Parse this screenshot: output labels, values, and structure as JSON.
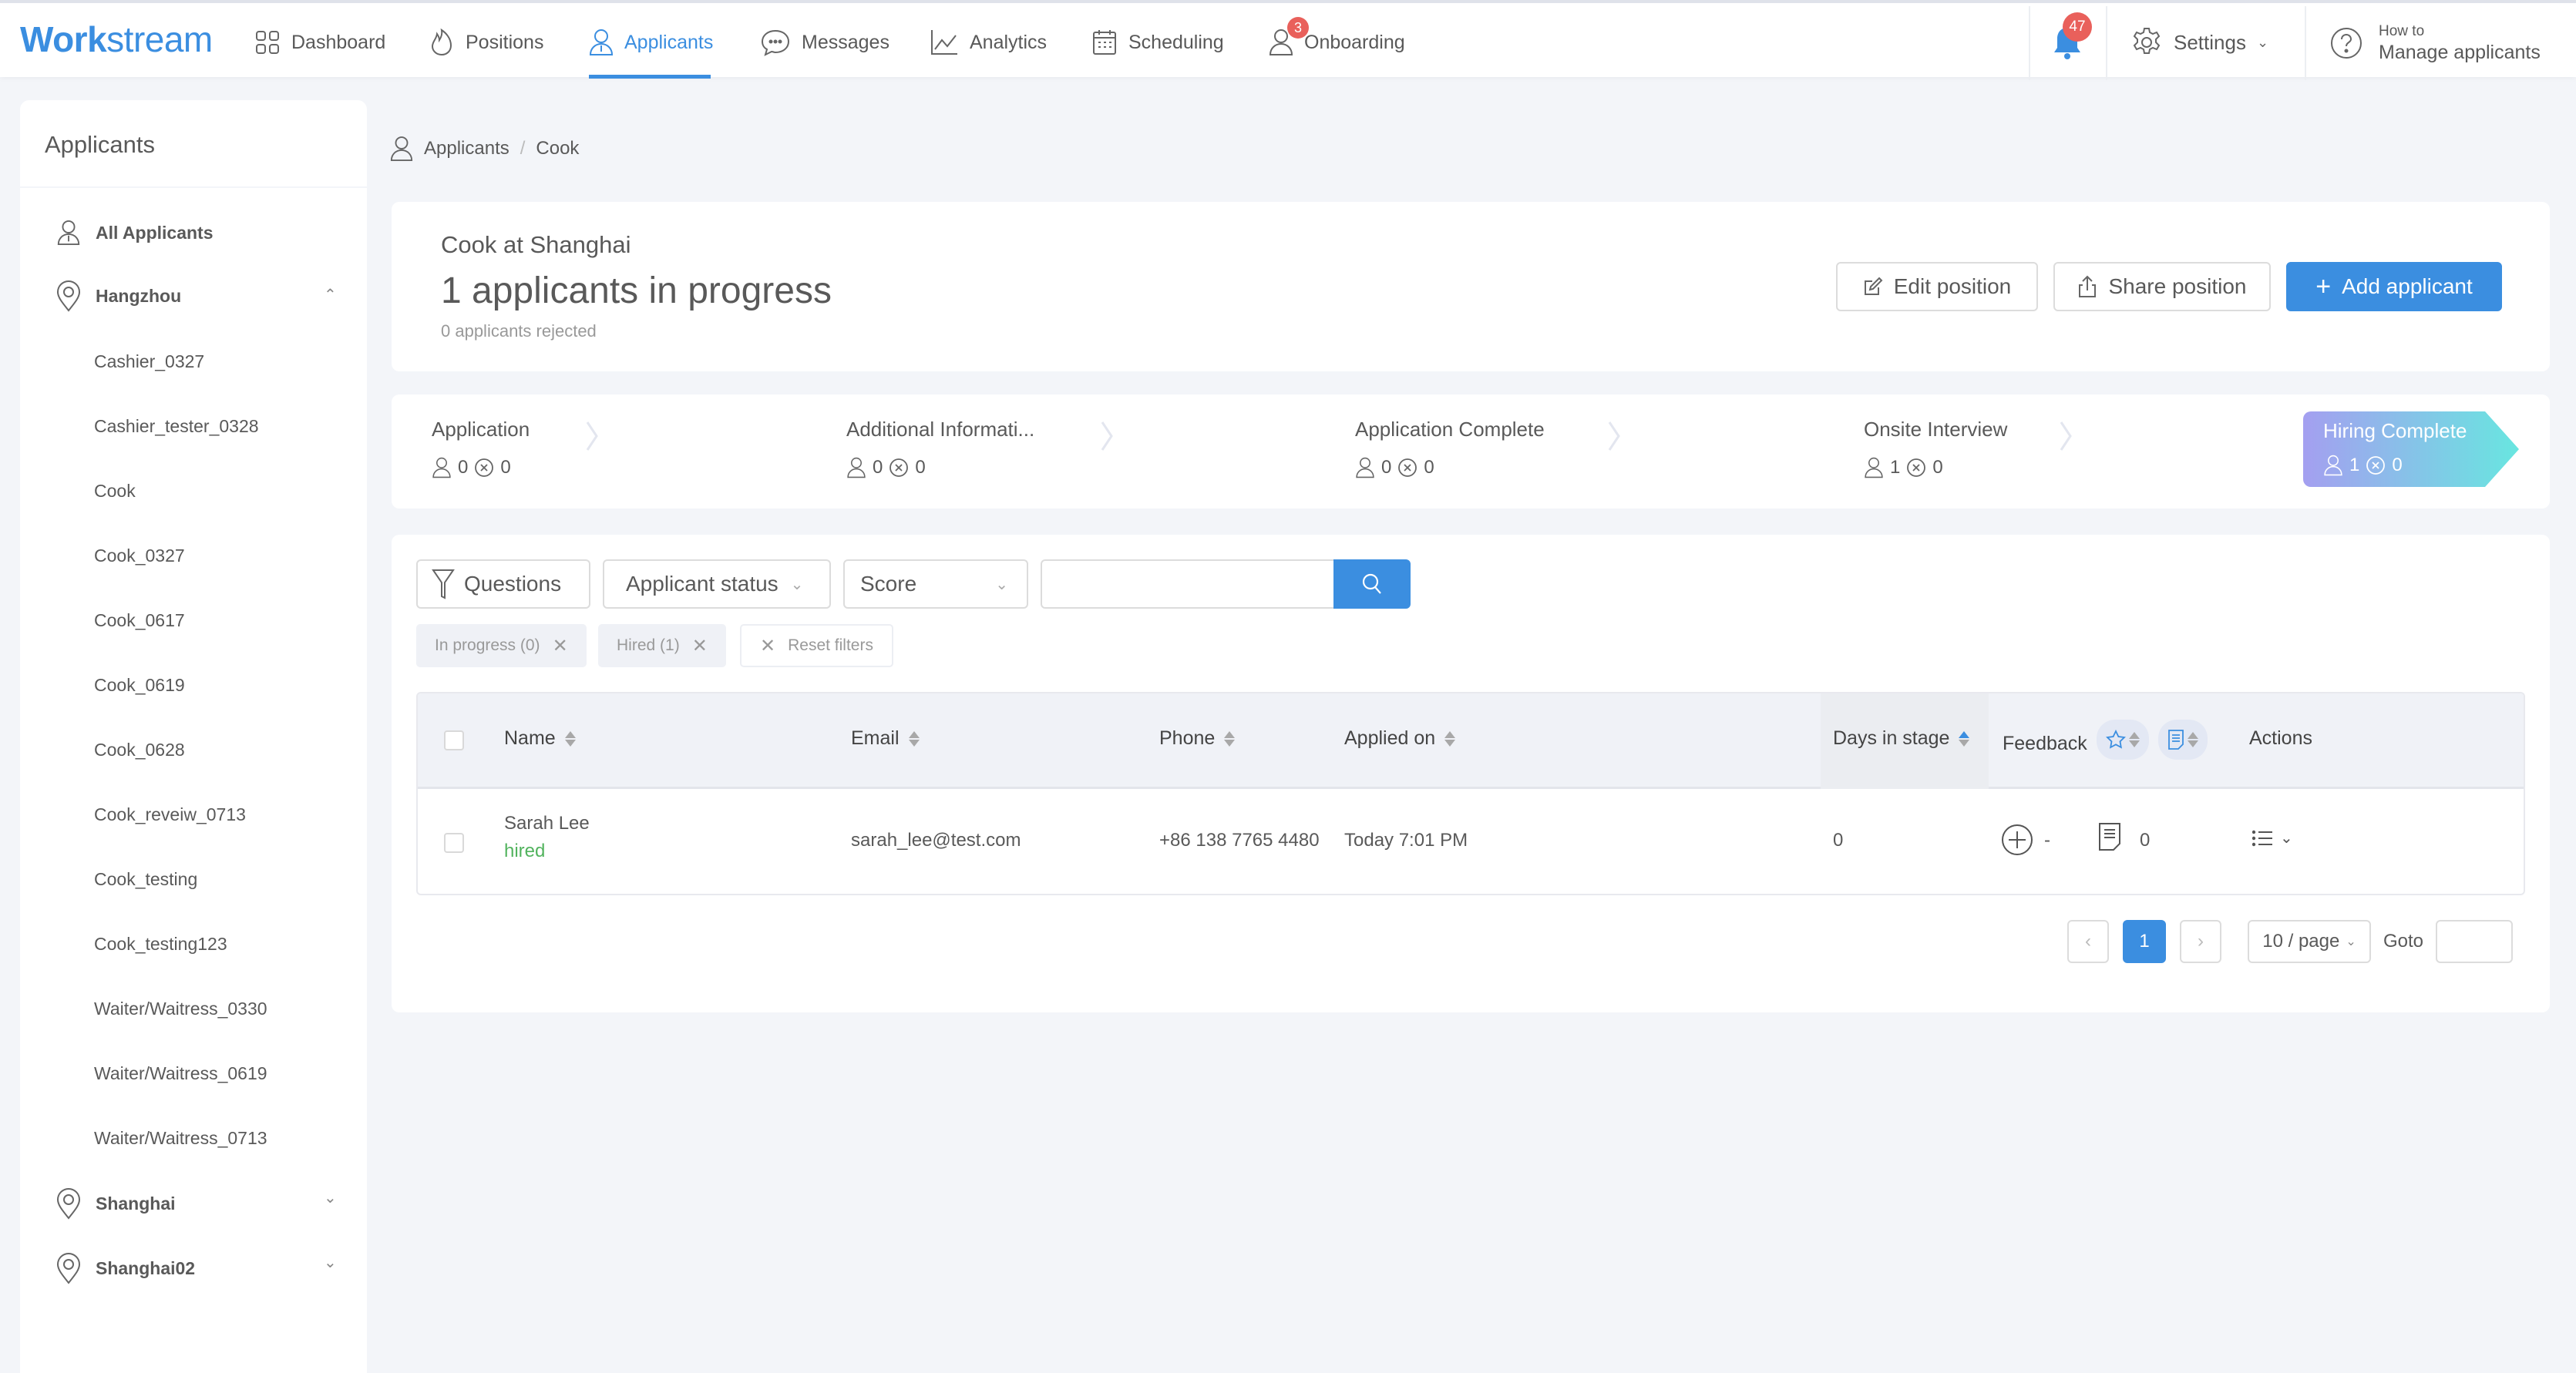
{
  "app": {
    "logo_bold": "Work",
    "logo_light": "stream",
    "brand_color": "#3b8ee0"
  },
  "nav": {
    "items": [
      {
        "label": "Dashboard",
        "icon": "dashboard-icon"
      },
      {
        "label": "Positions",
        "icon": "fire-icon"
      },
      {
        "label": "Applicants",
        "icon": "applicant-icon",
        "active": true
      },
      {
        "label": "Messages",
        "icon": "messages-icon"
      },
      {
        "label": "Analytics",
        "icon": "analytics-icon"
      },
      {
        "label": "Scheduling",
        "icon": "calendar-icon"
      },
      {
        "label": "Onboarding",
        "icon": "onboarding-icon",
        "badge": "3"
      }
    ],
    "notifications_badge": "47",
    "settings_label": "Settings",
    "help_small": "How to",
    "help_big": "Manage applicants"
  },
  "sidebar": {
    "title": "Applicants",
    "all_applicants": "All Applicants",
    "locations": [
      {
        "name": "Hangzhou",
        "expanded": true
      },
      {
        "name": "Shanghai",
        "expanded": false
      },
      {
        "name": "Shanghai02",
        "expanded": false
      }
    ],
    "hangzhou_positions": [
      "Cashier_0327",
      "Cashier_tester_0328",
      "Cook",
      "Cook_0327",
      "Cook_0617",
      "Cook_0619",
      "Cook_0628",
      "Cook_reveiw_0713",
      "Cook_testing",
      "Cook_testing123",
      "Waiter/Waitress_0330",
      "Waiter/Waitress_0619",
      "Waiter/Waitress_0713"
    ]
  },
  "breadcrumb": {
    "root": "Applicants",
    "separator": "/",
    "current": "Cook"
  },
  "position": {
    "subtitle": "Cook at Shanghai",
    "title": "1 applicants in progress",
    "rejected": "0 applicants rejected",
    "edit_label": "Edit position",
    "share_label": "Share position",
    "add_label": "Add applicant"
  },
  "stages": [
    {
      "name": "Application",
      "applicants": "0",
      "rejected": "0"
    },
    {
      "name": "Additional Informati...",
      "applicants": "0",
      "rejected": "0"
    },
    {
      "name": "Application Complete",
      "applicants": "0",
      "rejected": "0"
    },
    {
      "name": "Onsite Interview",
      "applicants": "1",
      "rejected": "0"
    },
    {
      "name": "Hiring Complete",
      "applicants": "1",
      "rejected": "0",
      "active": true
    }
  ],
  "filters": {
    "questions_label": "Questions",
    "status_label": "Applicant status",
    "score_label": "Score",
    "search_value": "",
    "chips": [
      "In progress (0)",
      "Hired (1)"
    ],
    "reset_label": "Reset filters"
  },
  "table": {
    "columns": {
      "name": "Name",
      "email": "Email",
      "phone": "Phone",
      "applied": "Applied on",
      "days": "Days in stage",
      "feedback": "Feedback",
      "actions": "Actions"
    },
    "rows": [
      {
        "name": "Sarah Lee",
        "status": "hired",
        "status_color": "#52b35e",
        "email": "sarah_lee@test.com",
        "phone": "+86 138 7765 4480",
        "applied": "Today 7:01 PM",
        "days": "0",
        "score": "-",
        "notes": "0"
      }
    ]
  },
  "pagination": {
    "current": "1",
    "page_size": "10 / page",
    "goto_label": "Goto",
    "goto_value": ""
  }
}
